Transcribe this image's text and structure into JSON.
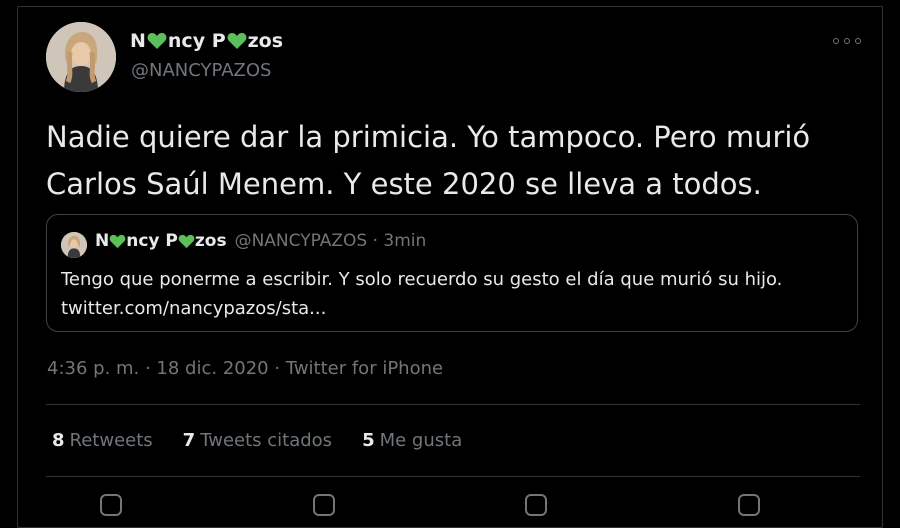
{
  "tweet": {
    "author": {
      "name_part1": "N",
      "name_part2": "ncy P",
      "name_part3": "zos",
      "handle": "@NANCYPAZOS",
      "heart_color": "#5bbf5a"
    },
    "text": "Nadie quiere dar la primicia. Yo tampoco. Pero murió Carlos Saúl Menem. Y este 2020 se lleva a todos.",
    "timestamp": "4:36 p. m. · 18 dic. 2020 · Twitter for iPhone",
    "stats": {
      "retweets_count": "8",
      "retweets_label": "Retweets",
      "quotes_count": "7",
      "quotes_label": "Tweets citados",
      "likes_count": "5",
      "likes_label": "Me gusta"
    }
  },
  "quoted_tweet": {
    "name_part1": "N",
    "name_part2": "ncy P",
    "name_part3": "zos",
    "meta": "@NANCYPAZOS · 3min",
    "text_line1": "Tengo que ponerme a escribir. Y solo recuerdo su gesto el día que murió su hijo.",
    "text_line2": "twitter.com/nancypazos/sta..."
  },
  "colors": {
    "background": "#000000",
    "text": "#e7e9ea",
    "secondary_text": "#71767b",
    "border": "#2f3336"
  }
}
